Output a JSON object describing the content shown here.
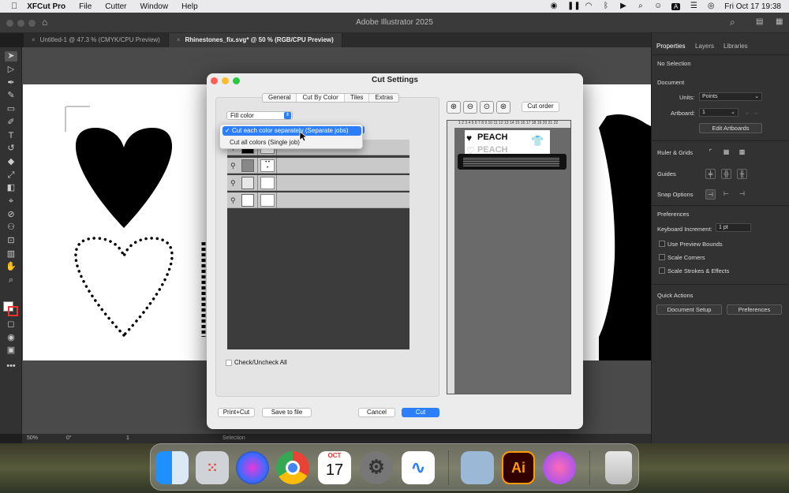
{
  "menubar": {
    "apple": "",
    "app": "XFCut Pro",
    "items": [
      "File",
      "Cutter",
      "Window",
      "Help"
    ],
    "input_badge": "A",
    "clock": "Fri Oct 17  19:38"
  },
  "window": {
    "title": "Adobe Illustrator 2025"
  },
  "doc_tabs": [
    {
      "label": "Untitled-1 @ 47.3 % (CMYK/CPU Preview)",
      "active": false
    },
    {
      "label": "Rhinestones_fix.svg* @ 50 % (RGB/CPU Preview)",
      "active": true
    }
  ],
  "status": {
    "zoom": "50%",
    "rotate": "0°",
    "artboard": "1",
    "mode": "Selection"
  },
  "panel": {
    "tabs": [
      "Properties",
      "Layers",
      "Libraries"
    ],
    "no_selection": "No Selection",
    "document": "Document",
    "units_label": "Units:",
    "units_value": "Points",
    "artboard_label": "Artboard:",
    "artboard_value": "1",
    "edit_artboards": "Edit Artboards",
    "ruler_grids": "Ruler & Grids",
    "guides": "Guides",
    "snap_options": "Snap Options",
    "preferences_head": "Preferences",
    "keyboard_inc_label": "Keyboard Increment:",
    "keyboard_inc_value": "1 pt",
    "use_preview_bounds": "Use Preview Bounds",
    "scale_corners": "Scale Corners",
    "scale_strokes": "Scale Strokes & Effects",
    "quick_actions": "Quick Actions",
    "document_setup": "Document Setup",
    "preferences_btn": "Preferences"
  },
  "dialog": {
    "title": "Cut Settings",
    "tabs": [
      "General",
      "Cut By Color",
      "Tiles",
      "Extras"
    ],
    "active_tab": "Cut By Color",
    "fill_mode": "Fill color",
    "menu_options": [
      "Cut each color separately (Separate jobs)",
      "Cut all colors (Single job)"
    ],
    "menu_checkmark": "✓",
    "check_all": "Check/Uncheck All",
    "print_cut": "Print+Cut",
    "save_to_file": "Save to file",
    "cancel": "Cancel",
    "cut": "Cut",
    "cut_order": "Cut order",
    "ruler_numbers": "1 2 3 4 5 6 7 8 9 10 11 12 13 14 15 16 17 18 19 20 21 22",
    "preview_text_1": "PEACH",
    "preview_text_2": "PEACH"
  },
  "colors": {
    "accent": "#2d7ff9",
    "dialog_bg": "#ececec",
    "panel_bg": "#323232"
  },
  "dock": [
    {
      "name": "Finder",
      "icon": "finder-icon"
    },
    {
      "name": "Launchpad",
      "icon": "launchpad-icon"
    },
    {
      "name": "Siri",
      "icon": "siri-icon"
    },
    {
      "name": "Chrome",
      "icon": "chrome-icon"
    },
    {
      "name": "Calendar",
      "icon": "calendar-icon",
      "month": "OCT",
      "day": "17"
    },
    {
      "name": "System Settings",
      "icon": "settings-icon"
    },
    {
      "name": "Freeform",
      "icon": "freeform-icon"
    },
    {
      "name": "Preview",
      "icon": "preview-icon"
    },
    {
      "name": "Illustrator",
      "icon": "illustrator-icon",
      "label": "Ai"
    },
    {
      "name": "XFCut",
      "icon": "xfcut-icon"
    },
    {
      "name": "Trash",
      "icon": "trash-icon"
    }
  ]
}
